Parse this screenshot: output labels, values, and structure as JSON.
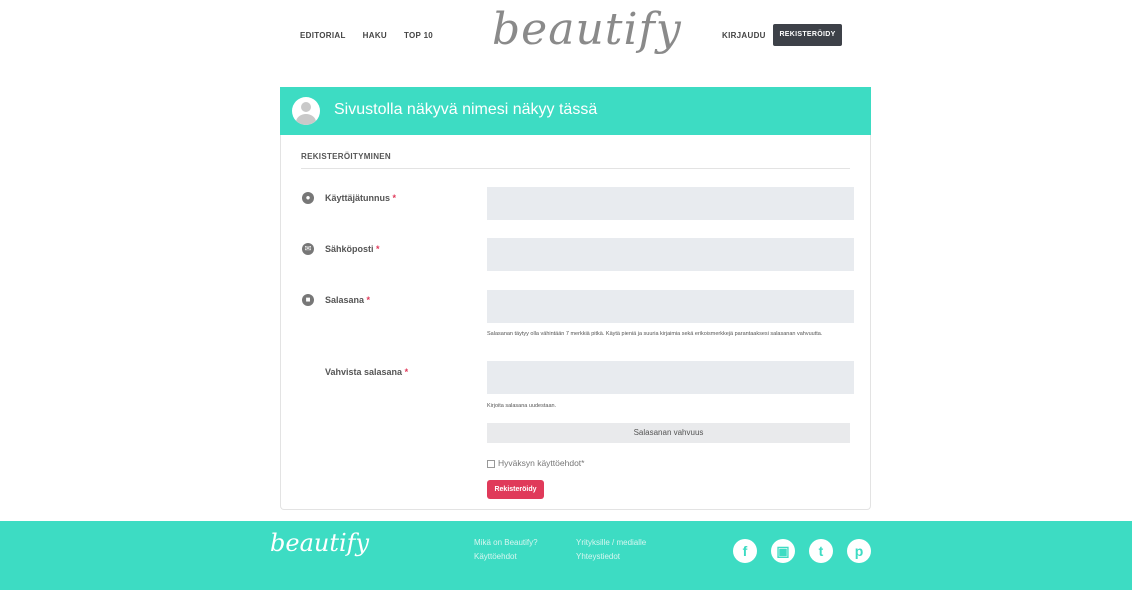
{
  "header": {
    "nav": [
      "EDITORIAL",
      "HAKU",
      "TOP 10"
    ],
    "logo": "beautify",
    "login": "KIRJAUDU",
    "register": "REKISTERÖIDY"
  },
  "form": {
    "title": "Sivustolla näkyvä nimesi näkyy tässä",
    "section": "REKISTERÖITYMINEN",
    "username_label": "Käyttäjätunnus",
    "email_label": "Sähköposti",
    "password_label": "Salasana",
    "password_hint": "Salasanan täytyy olla vähintään 7 merkkiä pitkä. Käytä pieniä ja suuria kirjaimia sekä erikoismerkkejä parantaaksesi salasanan vahvuutta.",
    "confirm_label": "Vahvista salasana",
    "confirm_hint": "Kirjoita salasana uudestaan.",
    "required_mark": "*",
    "strength": "Salasanan vahvuus",
    "terms": "Hyväksyn käyttöehdot*",
    "submit": "Rekisteröidy"
  },
  "footer": {
    "logo": "beautify",
    "links": [
      "Mikä on Beautify?",
      "Käyttöehdot",
      "Yrityksille / medialle",
      "Yhteystiedot"
    ],
    "social": [
      "facebook-icon",
      "instagram-icon",
      "twitter-icon",
      "pinterest-icon"
    ]
  },
  "colors": {
    "accent": "#3ddcc3",
    "button": "#e03a5a",
    "dark": "#3d4148"
  }
}
